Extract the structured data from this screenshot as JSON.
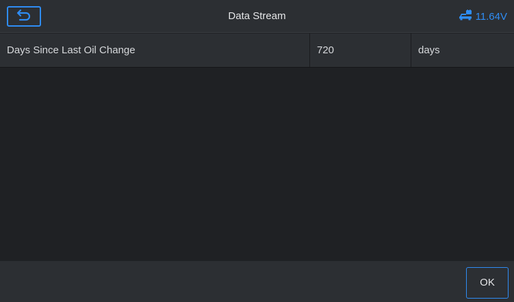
{
  "header": {
    "title": "Data Stream",
    "back_icon": "back-arrow-icon",
    "battery_icon": "vehicle-battery-icon",
    "battery_voltage": "11.64V"
  },
  "data_stream": {
    "rows": [
      {
        "name": "Days Since Last Oil Change",
        "value": "720",
        "unit": "days"
      }
    ]
  },
  "footer": {
    "ok_label": "OK"
  },
  "colors": {
    "accent": "#2f8df5",
    "background": "#1f2124",
    "panel": "#2c2f33"
  }
}
